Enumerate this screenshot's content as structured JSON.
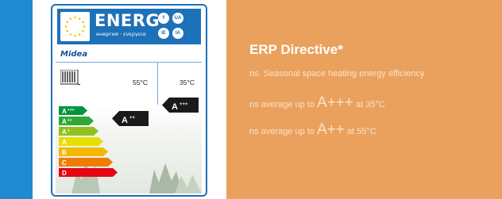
{
  "energy_label": {
    "header_title": "ENERG",
    "header_subtitle": "енергия · ενεργεια",
    "lang_badges": [
      "Y",
      "UA",
      "IE",
      "IA"
    ],
    "brand": "Midea",
    "temp_left": "55°C",
    "temp_right": "35°C",
    "scale": [
      {
        "letter": "A",
        "sup": "+++",
        "color": "#009640"
      },
      {
        "letter": "A",
        "sup": "++",
        "color": "#31a836"
      },
      {
        "letter": "A",
        "sup": "+",
        "color": "#93c01f"
      },
      {
        "letter": "A",
        "sup": "",
        "color": "#e6e000"
      },
      {
        "letter": "B",
        "sup": "",
        "color": "#f5b800"
      },
      {
        "letter": "C",
        "sup": "",
        "color": "#ef7d00"
      },
      {
        "letter": "D",
        "sup": "",
        "color": "#e30613"
      }
    ],
    "rating_55": {
      "letter": "A",
      "sup": "++"
    },
    "rating_35": {
      "letter": "A",
      "sup": "+++"
    }
  },
  "info": {
    "title": "ERP Directive*",
    "subtitle": "ns. Seasonal space heating energy efficiency",
    "line1": {
      "prefix": "ns average up to ",
      "rating": "A+++",
      "suffix": " at 35°C"
    },
    "line2": {
      "prefix": "ns average up to ",
      "rating": "A++",
      "suffix": " at 55°C"
    }
  },
  "colors": {
    "accent_blue": "#1f8ad1",
    "panel_orange": "#eaa15d"
  }
}
